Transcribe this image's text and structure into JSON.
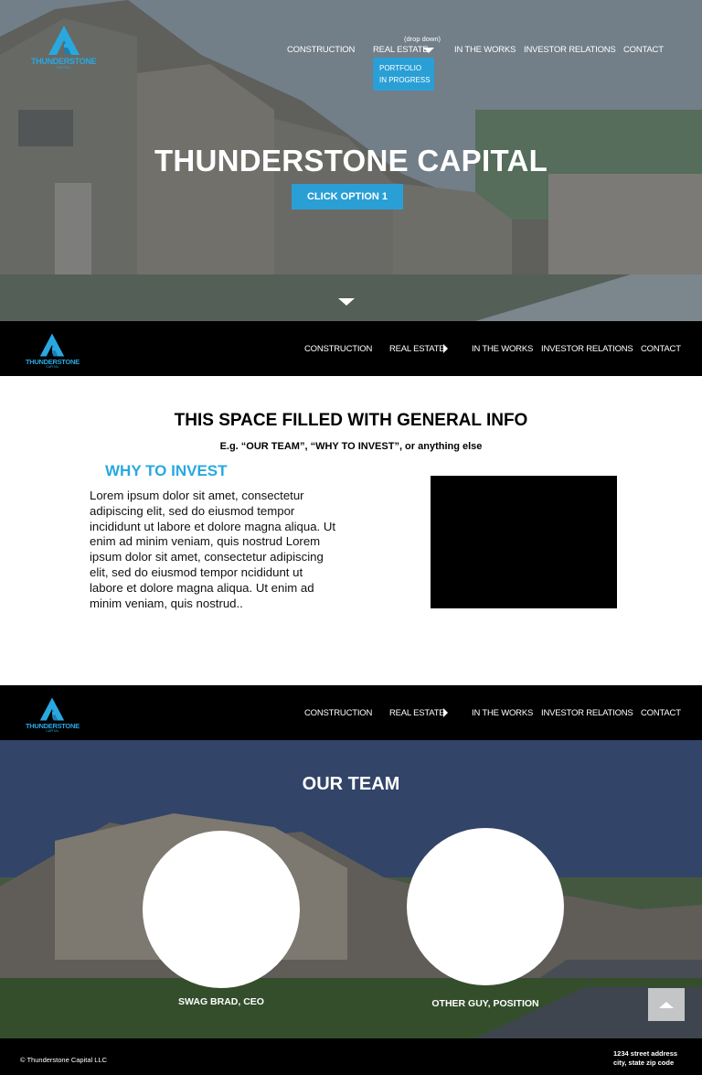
{
  "brand": {
    "logo_text": "THUNDERSTONE",
    "logo_sub": "CAPITAL",
    "accent_color": "#29a8e0",
    "button_color": "#2a9fd6"
  },
  "nav": {
    "construction": "CONSTRUCTION",
    "real_estate": "REAL ESTATE",
    "in_the_works": "IN THE WORKS",
    "investor_relations": "INVESTOR RELATIONS",
    "contact": "CONTACT",
    "dropdown_hint": "(drop down)",
    "dropdown_items": [
      "PORTFOLIO",
      "IN PROGRESS"
    ]
  },
  "hero": {
    "title": "THUNDERSTONE CAPITAL",
    "cta_label": "CLICK OPTION 1",
    "scroll_icon": "chevron-down-icon"
  },
  "info": {
    "title": "THIS SPACE FILLED WITH GENERAL INFO",
    "subtitle": "E.g. “OUR TEAM”,  “WHY TO INVEST”, or anything else",
    "why_title": "WHY TO INVEST",
    "why_body": "Lorem ipsum dolor sit amet, consectetur adipiscing elit, sed do eiusmod tempor incididunt ut labore et dolore magna aliqua. Ut enim ad minim veniam, quis nostrud Lorem ipsum dolor sit amet, consectetur adipiscing elit, sed do eiusmod tempor ncididunt ut labore et dolore magna aliqua. Ut enim ad minim veniam, quis nostrud.."
  },
  "team": {
    "title": "OUR TEAM",
    "members": [
      {
        "name": "SWAG BRAD, CEO"
      },
      {
        "name": "OTHER GUY, POSITION"
      }
    ],
    "to_top_icon": "arrow-up-icon"
  },
  "footer": {
    "copyright": "© Thunderstone Capital LLC",
    "address_line1": "1234 street address",
    "address_line2": "city, state zip code"
  }
}
